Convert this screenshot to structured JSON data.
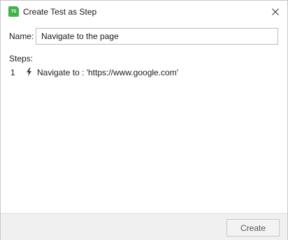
{
  "window": {
    "title": "Create Test as Step",
    "app_icon_text": "TS",
    "close_icon": "close-icon"
  },
  "form": {
    "name_label": "Name:",
    "name_value": "Navigate to the page"
  },
  "steps": {
    "label": "Steps:",
    "items": [
      {
        "number": "1",
        "icon": "bolt-icon",
        "text": "Navigate to : 'https://www.google.com'"
      }
    ]
  },
  "footer": {
    "create_label": "Create"
  },
  "colors": {
    "accent": "#3fb44a",
    "footer_bg": "#f0f0f0"
  }
}
